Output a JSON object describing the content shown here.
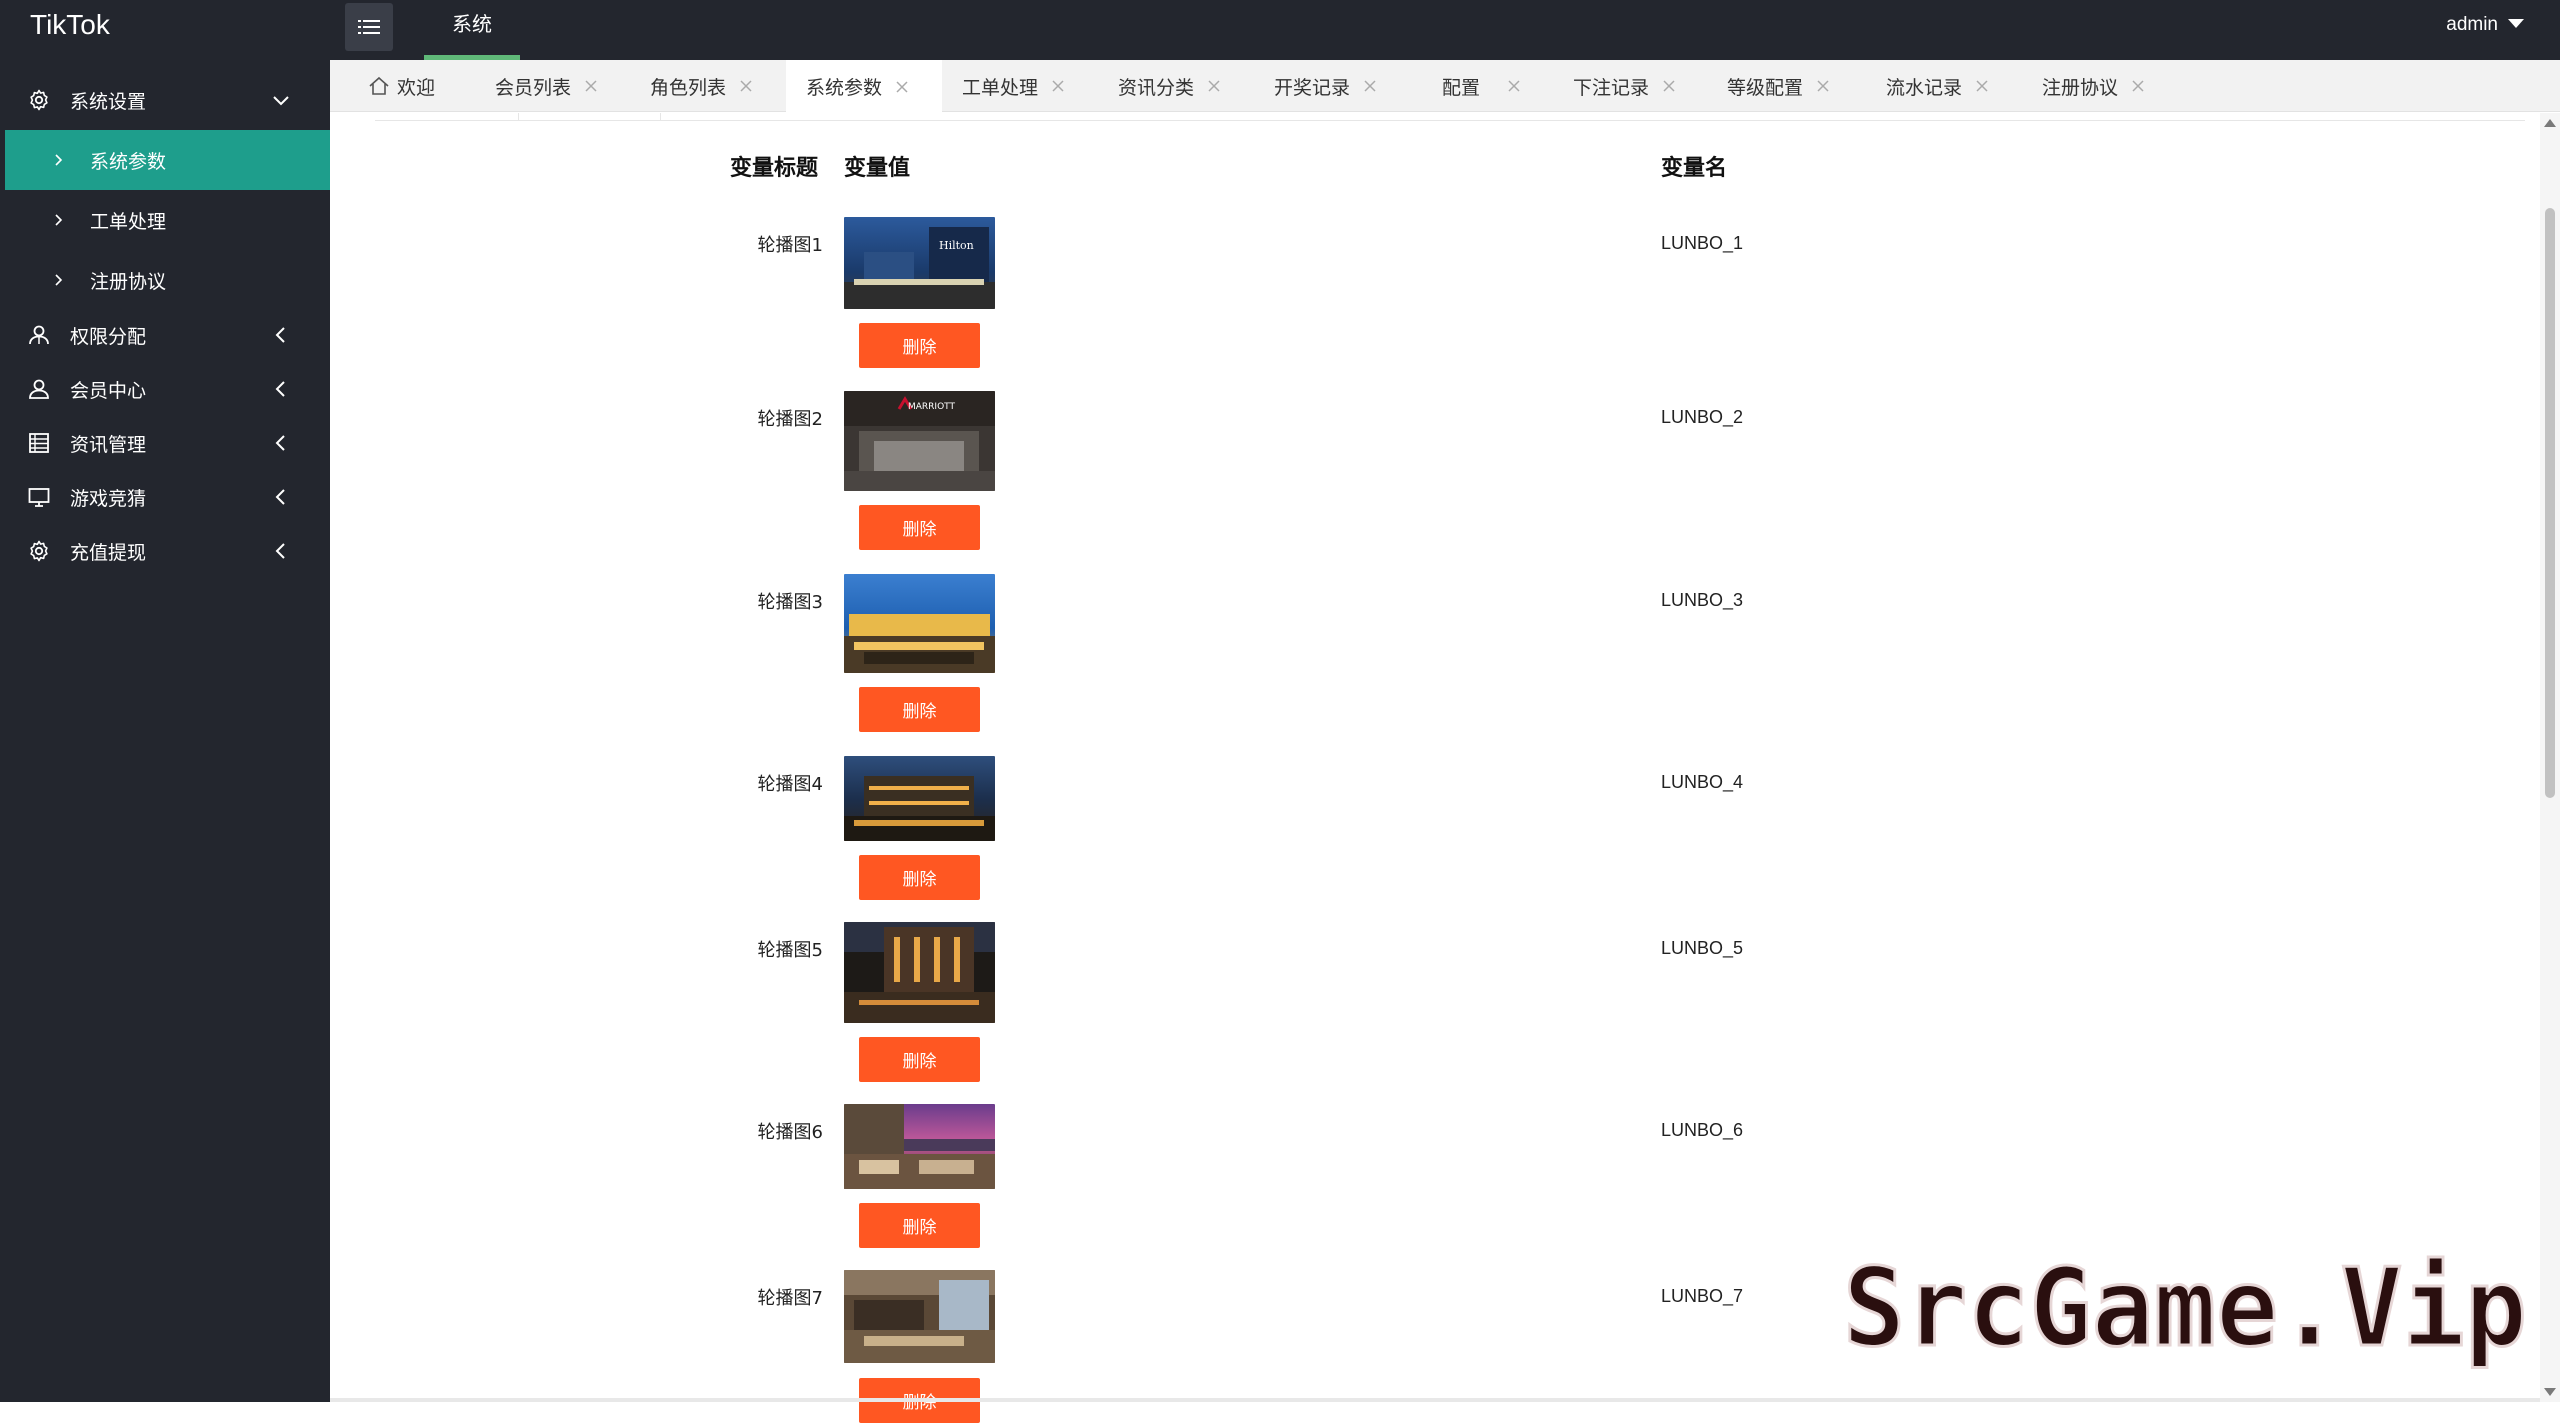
{
  "app": {
    "title": "TikTok"
  },
  "header": {
    "nav_label": "系统",
    "user_name": "admin",
    "accent": "#5fb878"
  },
  "sidebar": {
    "background": "#23262e",
    "active_color": "#1e9e8c",
    "groups": [
      {
        "label": "系统设置",
        "icon": "gear-icon",
        "expanded": true
      },
      {
        "label": "权限分配",
        "icon": "user-group-icon",
        "expanded": false
      },
      {
        "label": "会员中心",
        "icon": "user-icon",
        "expanded": false
      },
      {
        "label": "资讯管理",
        "icon": "list-icon",
        "expanded": false
      },
      {
        "label": "游戏竞猜",
        "icon": "monitor-icon",
        "expanded": false
      },
      {
        "label": "充值提现",
        "icon": "gear-icon",
        "expanded": false
      }
    ],
    "sub_items": [
      {
        "label": "系统参数",
        "active": true
      },
      {
        "label": "工单处理",
        "active": false
      },
      {
        "label": "注册协议",
        "active": false
      }
    ]
  },
  "tabs": [
    {
      "label": "欢迎",
      "closable": false,
      "active": false
    },
    {
      "label": "会员列表",
      "closable": true,
      "active": false
    },
    {
      "label": "角色列表",
      "closable": true,
      "active": false
    },
    {
      "label": "系统参数",
      "closable": true,
      "active": true
    },
    {
      "label": "工单处理",
      "closable": true,
      "active": false
    },
    {
      "label": "资讯分类",
      "closable": true,
      "active": false
    },
    {
      "label": "开奖记录",
      "closable": true,
      "active": false
    },
    {
      "label": "配置",
      "closable": true,
      "active": false
    },
    {
      "label": "下注记录",
      "closable": true,
      "active": false
    },
    {
      "label": "等级配置",
      "closable": true,
      "active": false
    },
    {
      "label": "流水记录",
      "closable": true,
      "active": false
    },
    {
      "label": "注册协议",
      "closable": true,
      "active": false
    }
  ],
  "table": {
    "headers": {
      "title": "变量标题",
      "value": "变量值",
      "name": "变量名"
    },
    "delete_label": "删除",
    "delete_color": "#ff5722",
    "rows": [
      {
        "title": "轮播图1",
        "name": "LUNBO_1",
        "image": "hotel-photo-hilton"
      },
      {
        "title": "轮播图2",
        "name": "LUNBO_2",
        "image": "hotel-photo-marriott"
      },
      {
        "title": "轮播图3",
        "name": "LUNBO_3",
        "image": "hotel-photo-blue-facade"
      },
      {
        "title": "轮播图4",
        "name": "LUNBO_4",
        "image": "hotel-photo-night-terrace"
      },
      {
        "title": "轮播图5",
        "name": "LUNBO_5",
        "image": "hotel-photo-street-night"
      },
      {
        "title": "轮播图6",
        "name": "LUNBO_6",
        "image": "hotel-photo-lounge-sunset"
      },
      {
        "title": "轮播图7",
        "name": "LUNBO_7",
        "image": "hotel-photo-lobby"
      }
    ]
  },
  "watermark": {
    "text": "SrcGame.Vip"
  }
}
